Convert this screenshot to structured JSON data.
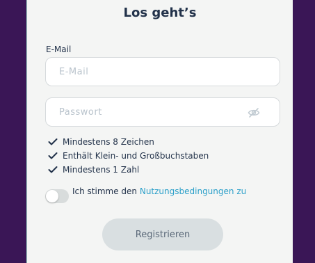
{
  "header": {
    "title": "Los geht’s"
  },
  "form": {
    "email_label": "E-Mail",
    "email_placeholder": "E-Mail",
    "email_value": "",
    "password_placeholder": "Passwort",
    "password_value": ""
  },
  "requirements": [
    {
      "label": "Mindestens 8 Zeichen",
      "met": true
    },
    {
      "label": "Enthält Klein- und Großbuchstaben",
      "met": true
    },
    {
      "label": "Mindestens 1 Zahl",
      "met": true
    }
  ],
  "consent": {
    "checked": false,
    "prefix": "Ich stimme den ",
    "link_text": "Nutzungsbedingungen zu"
  },
  "submit": {
    "label": "Registrieren",
    "enabled": false
  },
  "icons": {
    "password_visibility": "eye-off-icon",
    "requirement_check": "checkmark-icon"
  },
  "colors": {
    "background": "#3a1656",
    "card": "#f4f5f4",
    "text": "#22324a",
    "link": "#2a9fc9",
    "placeholder": "#b9c3cc",
    "button_disabled": "#d9dfe1"
  }
}
